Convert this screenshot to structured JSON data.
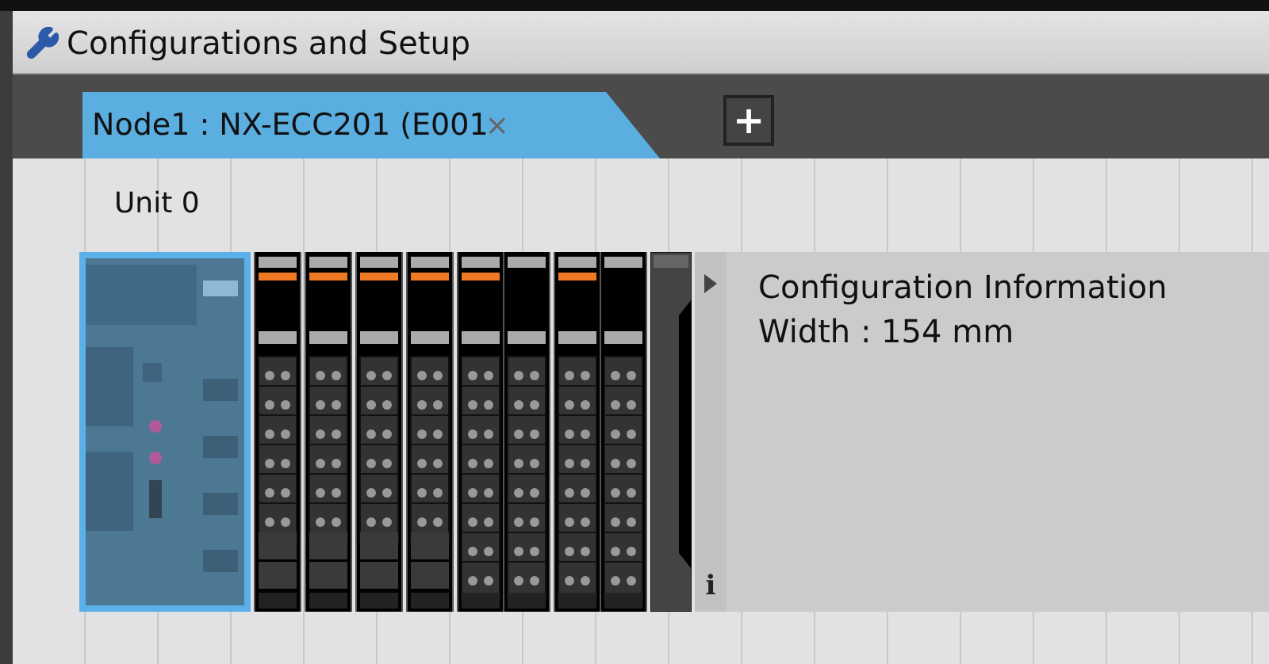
{
  "window": {
    "title": "Configurations and Setup"
  },
  "tabs": [
    {
      "label": "Node1 : NX-ECC201 (E001",
      "close": "×",
      "selected": true
    }
  ],
  "add_tab": "+",
  "unit_label": "Unit 0",
  "modules": [
    {
      "kind": "coupler",
      "selected": true
    },
    {
      "kind": "io-short",
      "slots": [
        {
          "lit": true
        }
      ]
    },
    {
      "kind": "io-short",
      "slots": [
        {
          "lit": true
        }
      ]
    },
    {
      "kind": "io-short",
      "slots": [
        {
          "lit": true
        }
      ]
    },
    {
      "kind": "io-short",
      "slots": [
        {
          "lit": true
        }
      ]
    },
    {
      "kind": "io-full",
      "slots": [
        {
          "lit": true
        },
        {
          "lit": false
        }
      ]
    },
    {
      "kind": "io-full",
      "slots": [
        {
          "lit": true
        },
        {
          "lit": false
        }
      ]
    },
    {
      "kind": "end-cover"
    }
  ],
  "info_panel": {
    "expanded": false,
    "title": "Configuration Information",
    "width": "Width : 154 mm",
    "info_mark": "i"
  }
}
